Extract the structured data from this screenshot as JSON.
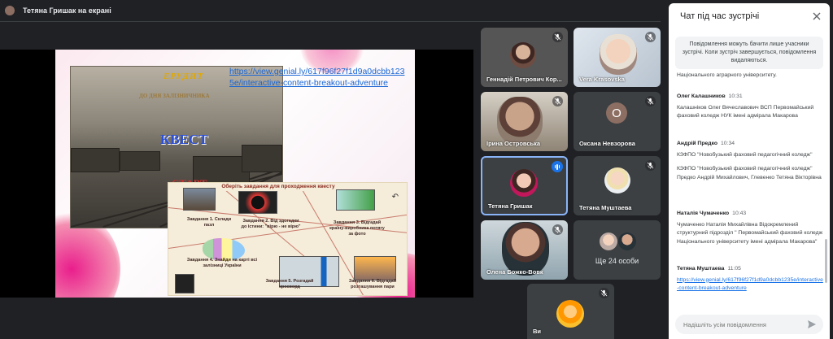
{
  "top": {
    "title": "Тетяна Гришак на екрані"
  },
  "slide": {
    "link": "https://view.genial.ly/617f96f27f1d9a0dcbb1235e/interactive-content-breakout-adventure",
    "brand": "ЕРУДИТ",
    "subtitle": "ДО ДНЯ ЗАЛІЗНИЧНИКА",
    "quest": "КВЕСТ",
    "start": "СТАРТ",
    "map_title": "Оберіть завдання для проходження квесту",
    "tasks": [
      "Завдання 1. Склади пазл",
      "Завдання 2. Від здогадки до істини: \"вірю - не вірю\"",
      "Завдання 3. Відгадай країну-виробника потягу за фото",
      "Завдання 4. Знайди на карті всі залізниці України",
      "Завдання 5. Розгадай кросворд",
      "Завдання 6. Відгадай розташування пари"
    ]
  },
  "participants": [
    {
      "name": "Геннадій Петрович Кор...",
      "muted": true
    },
    {
      "name": "Vera Krasovska",
      "muted": true
    },
    {
      "name": "Ірина Островська",
      "muted": true
    },
    {
      "name": "Оксана Невзорова",
      "muted": true,
      "initial": "О"
    },
    {
      "name": "Тетяна Гришак",
      "speaking": true
    },
    {
      "name": "Тетяна Муштаева",
      "muted": true
    },
    {
      "name": "Олена Божко-Вовк",
      "muted": true
    },
    {
      "name": "Ви",
      "muted": true
    }
  ],
  "more_tile": {
    "label": "Ще 24 особи"
  },
  "chat": {
    "title": "Чат під час зустрічі",
    "notice": "Повідомлення можуть бачити лише учасники зустрічі. Коли зустріч завершується, повідомлення видаляються.",
    "truncated_top": "Національного аграрного університету.",
    "messages": [
      {
        "sender": "Олег Калашников",
        "time": "10:31",
        "texts": [
          "Калашніков Олег Вячеславович ВСП Первомайський фаховий коледж НУК імені адмірала Макарова"
        ]
      },
      {
        "sender": "Андрій Предко",
        "time": "10:34",
        "texts": [
          "КЗФПО \"Новобузький фаховий педагогічний коледж\"",
          "КЗФПО \"Новобузький фаховий педагогічний коледж\" Предко Андрій Михайлович, Глевенко Тетяна Вікторівна"
        ]
      },
      {
        "sender": "Наталія Чумаченко",
        "time": "10:43",
        "texts": [
          "Чумаченко Наталія Михайлівна Відокремлений структурний підрозділ \" Первомайський фаховий коледж Національного університету імені адмірала Макарова\""
        ]
      },
      {
        "sender": "Тетяна Муштаева",
        "time": "11:05",
        "texts": [
          "https://view.genial.ly/617f96f27f1d9a0dcbb1235e/interactive-content-breakout-adventure"
        ]
      }
    ],
    "input_placeholder": "Надішліть усім повідомлення"
  },
  "colors": {
    "accent": "#1a73e8",
    "background": "#202124",
    "tile": "#3c4043"
  }
}
